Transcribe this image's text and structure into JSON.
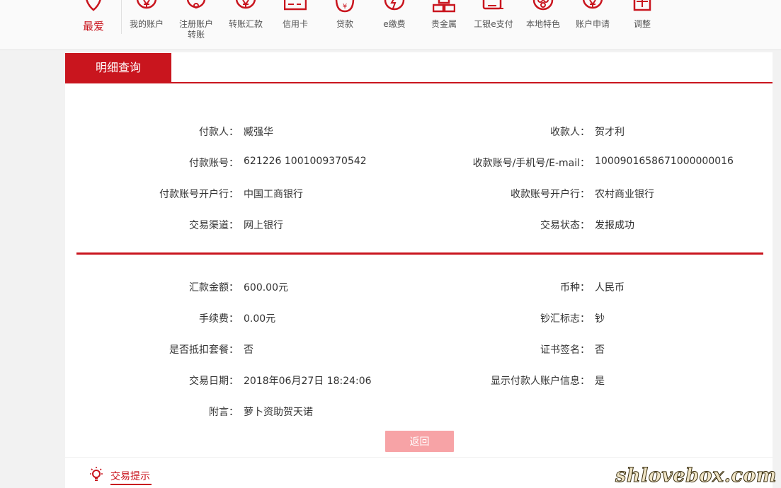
{
  "nav": {
    "items": [
      {
        "label": "最爱",
        "icon": "heart-icon"
      },
      {
        "label": "我的账户",
        "icon": "yuan-chat-icon"
      },
      {
        "label": "注册账户\n转账",
        "icon": "register-transfer-icon"
      },
      {
        "label": "转账汇款",
        "icon": "transfer-icon"
      },
      {
        "label": "信用卡",
        "icon": "credit-card-icon"
      },
      {
        "label": "贷款",
        "icon": "loan-bag-icon"
      },
      {
        "label": "e缴费",
        "icon": "lightning-icon"
      },
      {
        "label": "贵金属",
        "icon": "gold-bars-icon"
      },
      {
        "label": "工银e支付",
        "icon": "e-pay-icon"
      },
      {
        "label": "本地特色",
        "icon": "local-icon"
      },
      {
        "label": "账户申请",
        "icon": "account-apply-icon"
      },
      {
        "label": "调整",
        "icon": "adjust-icon"
      }
    ],
    "accent": "#c9151e"
  },
  "panel": {
    "tab_label": "明细查询",
    "section1": {
      "left": [
        {
          "label": "付款人：",
          "value": "臧强华"
        },
        {
          "label": "付款账号：",
          "value": "621226 1001009370542"
        },
        {
          "label": "付款账号开户行：",
          "value": "中国工商银行"
        },
        {
          "label": "交易渠道：",
          "value": "网上银行"
        }
      ],
      "right": [
        {
          "label": "收款人：",
          "value": "贺才利"
        },
        {
          "label": "收款账号/手机号/E-mail：",
          "value": "1000901658671000000016"
        },
        {
          "label": "收款账号开户行：",
          "value": "农村商业银行"
        },
        {
          "label": "交易状态：",
          "value": "发报成功"
        }
      ]
    },
    "section2": {
      "left": [
        {
          "label": "汇款金额：",
          "value": "600.00元"
        },
        {
          "label": "手续费：",
          "value": "0.00元"
        },
        {
          "label": "是否抵扣套餐：",
          "value": "否"
        },
        {
          "label": "交易日期：",
          "value": "2018年06月27日 18:24:06"
        },
        {
          "label": "附言：",
          "value": "萝卜资助贺天诺"
        }
      ],
      "right": [
        {
          "label": "币种：",
          "value": "人民币"
        },
        {
          "label": "钞汇标志：",
          "value": "钞"
        },
        {
          "label": "证书签名：",
          "value": "否"
        },
        {
          "label": "显示付款人账户信息：",
          "value": "是"
        }
      ]
    },
    "back_button": "返回",
    "button_color": "#f7a3a6"
  },
  "tips": {
    "label": "交易提示",
    "icon": "lightbulb-icon"
  },
  "watermark": "shlovebox.com"
}
